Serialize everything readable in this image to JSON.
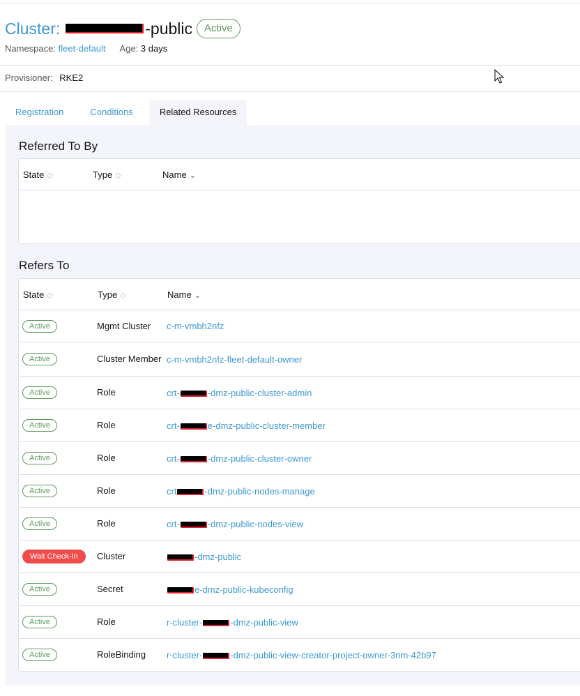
{
  "header": {
    "title_prefix": "Cluster:",
    "title_suffix": "-public",
    "status": "Active"
  },
  "meta": {
    "namespace_label": "Namespace:",
    "namespace_value": "fleet-default",
    "age_label": "Age:",
    "age_value": "3 days"
  },
  "provisioner": {
    "label": "Provisioner:",
    "value": "RKE2"
  },
  "tabs": [
    {
      "label": "Registration"
    },
    {
      "label": "Conditions"
    },
    {
      "label": "Related Resources"
    }
  ],
  "referred_to_by": {
    "title": "Referred To By",
    "columns": {
      "state": "State",
      "type": "Type",
      "name": "Name"
    },
    "rows": []
  },
  "refers_to": {
    "title": "Refers To",
    "columns": {
      "state": "State",
      "type": "Type",
      "name": "Name"
    },
    "rows": [
      {
        "state": "Active",
        "type": "Mgmt Cluster",
        "name_pre": "c-m-vmbh2nfz",
        "name_post": ""
      },
      {
        "state": "Active",
        "type": "Cluster Member",
        "name_pre": "c-m-vmbh2nfz-fleet-default-owner",
        "name_post": ""
      },
      {
        "state": "Active",
        "type": "Role",
        "name_pre": "crt-",
        "name_post": "-dmz-public-cluster-admin"
      },
      {
        "state": "Active",
        "type": "Role",
        "name_pre": "crt-",
        "name_post": "e-dmz-public-cluster-member"
      },
      {
        "state": "Active",
        "type": "Role",
        "name_pre": "crt-",
        "name_post": "-dmz-public-cluster-owner"
      },
      {
        "state": "Active",
        "type": "Role",
        "name_pre": "crt",
        "name_post": "-dmz-public-nodes-manage"
      },
      {
        "state": "Active",
        "type": "Role",
        "name_pre": "crt-",
        "name_post": "-dmz-public-nodes-view"
      },
      {
        "state": "Wait Check-In",
        "type": "Cluster",
        "name_pre": "",
        "name_post": "-dmz-public"
      },
      {
        "state": "Active",
        "type": "Secret",
        "name_pre": "",
        "name_post": "e-dmz-public-kubeconfig"
      },
      {
        "state": "Active",
        "type": "Role",
        "name_pre": "r-cluster-",
        "name_post": "-dmz-public-view"
      },
      {
        "state": "Active",
        "type": "RoleBinding",
        "name_pre": "r-cluster-",
        "name_post": "-dmz-public-view-creator-project-owner-3nm-42b97"
      }
    ]
  },
  "colors": {
    "link": "#3d98d3",
    "active": "#5d995d",
    "warn": "#f04c4c",
    "panel_bg": "#f4f5fa"
  },
  "icons": {
    "sort": "sort-icon",
    "cursor": "mouse-pointer-icon"
  }
}
